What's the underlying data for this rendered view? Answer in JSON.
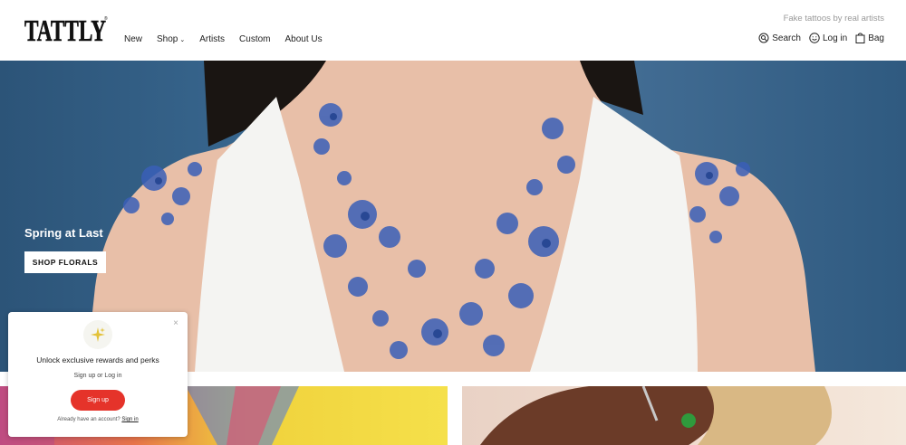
{
  "brand": {
    "logo_text": "TATTLY",
    "tagline": "Fake tattoos by real artists"
  },
  "nav": [
    {
      "label": "New"
    },
    {
      "label": "Shop",
      "has_dropdown": true
    },
    {
      "label": "Artists"
    },
    {
      "label": "Custom"
    },
    {
      "label": "About Us"
    }
  ],
  "utility": {
    "search_label": "Search",
    "login_label": "Log in",
    "bag_label": "Bag"
  },
  "hero": {
    "title": "Spring at Last",
    "cta_label": "SHOP FLORALS"
  },
  "popup": {
    "title": "Unlock exclusive rewards and perks",
    "subtitle": "Sign up or Log in",
    "button_label": "Sign up",
    "footer_text": "Already have an account?",
    "footer_link": "Sign in",
    "close_symbol": "×"
  },
  "colors": {
    "accent_red": "#e5332a",
    "hero_blue": "#3b6b94",
    "tattoo_blue": "#3a5fb8"
  }
}
